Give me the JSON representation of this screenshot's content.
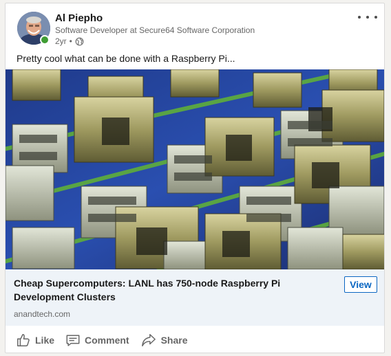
{
  "post": {
    "author_name": "Al Piepho",
    "author_headline": "Software Developer at Secure64 Software Corporation",
    "timestamp": "2yr",
    "visibility_separator": "•",
    "visibility_icon": "globe-icon",
    "text": "Pretty cool what can be done with a Raspberry Pi..."
  },
  "link_preview": {
    "title": "Cheap Supercomputers: LANL has 750-node Raspberry Pi Development Clusters",
    "source": "anandtech.com",
    "view_label": "View"
  },
  "actions": [
    {
      "label": "Like",
      "icon": "thumbs-up-icon"
    },
    {
      "label": "Comment",
      "icon": "comment-icon"
    },
    {
      "label": "Share",
      "icon": "share-icon"
    }
  ],
  "colors": {
    "accent": "#0a66c2",
    "presence": "#3f9d34",
    "link_background": "#eef3f8",
    "secondary_text": "#666666"
  }
}
